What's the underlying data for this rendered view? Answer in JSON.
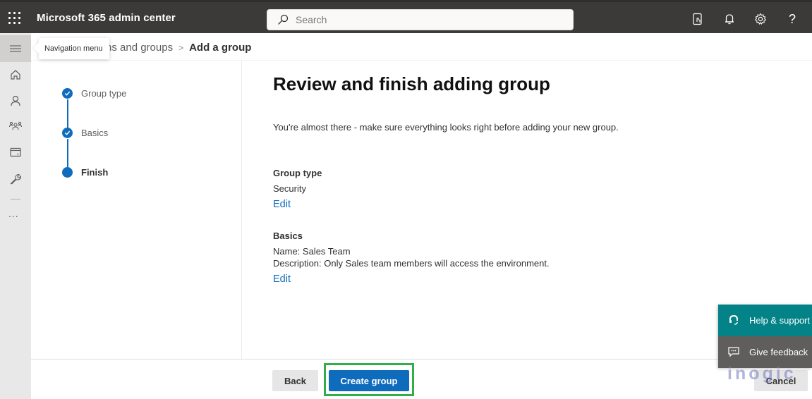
{
  "header": {
    "app_title": "Microsoft 365 admin center",
    "search_placeholder": "Search",
    "icons": [
      "app-launcher-icon",
      "mobile-app-icon",
      "notifications-bell-icon",
      "settings-gear-icon",
      "help-question-icon"
    ]
  },
  "leftnav": {
    "tooltip": "Navigation menu",
    "items": [
      {
        "icon": "hamburger-icon",
        "label": "Navigation menu"
      },
      {
        "icon": "home-icon"
      },
      {
        "icon": "user-icon"
      },
      {
        "icon": "teams-groups-icon"
      },
      {
        "icon": "billing-card-icon"
      },
      {
        "icon": "setup-wrench-icon"
      },
      {
        "icon": "more-ellipsis-icon",
        "label": "..."
      }
    ]
  },
  "breadcrumb": {
    "items": [
      "Teams and groups",
      "Add a group"
    ],
    "visible_partial": "ns and groups",
    "separator": ">",
    "current": "Add a group"
  },
  "wizard": {
    "steps": [
      {
        "label": "Group type",
        "status": "completed"
      },
      {
        "label": "Basics",
        "status": "completed"
      },
      {
        "label": "Finish",
        "status": "current"
      }
    ]
  },
  "main": {
    "title": "Review and finish adding group",
    "intro": "You're almost there - make sure everything looks right before adding your new group.",
    "sections": [
      {
        "title": "Group type",
        "lines": [
          "Security"
        ],
        "edit_label": "Edit"
      },
      {
        "title": "Basics",
        "lines": [
          "Name: Sales Team",
          "Description: Only Sales team members will access the environment."
        ],
        "edit_label": "Edit"
      }
    ]
  },
  "footer": {
    "back_label": "Back",
    "create_label": "Create group",
    "cancel_label": "Cancel"
  },
  "floating_panel": {
    "help_label": "Help & support",
    "feedback_label": "Give feedback"
  },
  "watermark": "inogic",
  "colors": {
    "topbar": "#3b3a39",
    "primary": "#0f6cbd",
    "help": "#038387",
    "feedback": "#605e5c",
    "highlight": "#2fae4a"
  }
}
